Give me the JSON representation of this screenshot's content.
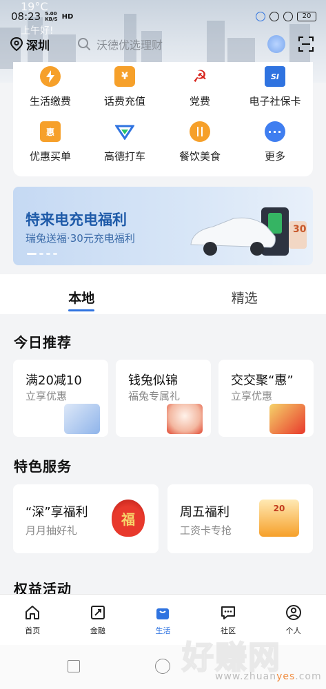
{
  "status_bar": {
    "time": "08:23",
    "network_speed": "5.00",
    "network_unit": "KB/S",
    "hd": "HD",
    "battery": "20"
  },
  "weather": {
    "temp": "19°C",
    "greeting": "上午好!"
  },
  "header": {
    "city": "深圳",
    "search_placeholder": "沃德优选理财"
  },
  "services": [
    {
      "label": "生活缴费",
      "icon": "bolt-icon",
      "color": "#f6a02a"
    },
    {
      "label": "话费充值",
      "icon": "yen-icon",
      "color": "#f6a02a"
    },
    {
      "label": "党费",
      "icon": "party-emblem-icon",
      "color": "#d8261f"
    },
    {
      "label": "电子社保卡",
      "icon": "social-security-card-icon",
      "color": "#2f73e0"
    },
    {
      "label": "优惠买单",
      "icon": "discount-ticket-icon",
      "color": "#f6a02a"
    },
    {
      "label": "高德打车",
      "icon": "amap-taxi-icon",
      "color": "#2f73e0"
    },
    {
      "label": "餐饮美食",
      "icon": "cutlery-icon",
      "color": "#f6a02a"
    },
    {
      "label": "更多",
      "icon": "more-icon",
      "color": "#3f7ef0"
    }
  ],
  "banner": {
    "title": "特来电充电福利",
    "subtitle": "瑞兔送福·30元充电福利",
    "badge": "30"
  },
  "tabs": [
    {
      "label": "本地",
      "active": true
    },
    {
      "label": "精选",
      "active": false
    }
  ],
  "recommend": {
    "title": "今日推荐",
    "cards": [
      {
        "title": "满20减10",
        "subtitle": "立享优惠"
      },
      {
        "title": "钱兔似锦",
        "subtitle": "福兔专属礼"
      },
      {
        "title": "交交聚“惠”",
        "subtitle": "立享优惠"
      }
    ]
  },
  "featured": {
    "title": "特色服务",
    "cards": [
      {
        "title": "“深”享福利",
        "subtitle": "月月抽好礼",
        "art_text": "福"
      },
      {
        "title": "周五福利",
        "subtitle": "工资卡专抢",
        "art_text": "20"
      }
    ]
  },
  "rights": {
    "title": "权益活动"
  },
  "bottom_nav": [
    {
      "label": "首页",
      "icon": "home-icon",
      "active": false
    },
    {
      "label": "金融",
      "icon": "finance-icon",
      "active": false
    },
    {
      "label": "生活",
      "icon": "shopping-bag-icon",
      "active": true
    },
    {
      "label": "社区",
      "icon": "chat-icon",
      "active": false
    },
    {
      "label": "个人",
      "icon": "person-icon",
      "active": false
    }
  ],
  "watermark": {
    "big": "好赚网",
    "small_pre": "www.zhuan",
    "small_hl": "yes",
    "small_post": ".com"
  },
  "colors": {
    "accent": "#2f73e0",
    "orange": "#f6a02a",
    "red": "#d8261f"
  }
}
